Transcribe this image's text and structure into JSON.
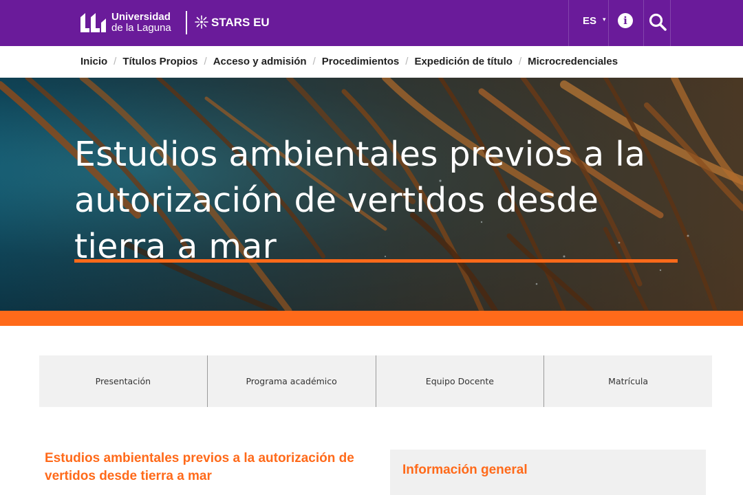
{
  "header": {
    "logo_line1": "Universidad",
    "logo_line2": "de la Laguna",
    "stars_label": "STARS EU",
    "language": "ES"
  },
  "nav": {
    "items": [
      {
        "label": "Inicio"
      },
      {
        "label": "Títulos Propios"
      },
      {
        "label": "Acceso y admisión"
      },
      {
        "label": "Procedimientos"
      },
      {
        "label": "Expedición de título"
      },
      {
        "label": "Microcredenciales"
      }
    ],
    "separator": "/"
  },
  "hero": {
    "title": "Estudios ambientales previos a la autorización de vertidos desde tierra a mar"
  },
  "tabs": [
    {
      "label": "Presentación"
    },
    {
      "label": "Programa académico"
    },
    {
      "label": "Equipo Docente"
    },
    {
      "label": "Matrícula"
    }
  ],
  "content": {
    "title": "Estudios ambientales previos a la autorización de vertidos desde tierra a mar",
    "info_heading": "Información general"
  },
  "colors": {
    "brand_purple": "#6a1b9a",
    "accent_orange": "#ff6a1a"
  },
  "icons": {
    "logo": "ull-logo-icon",
    "stars": "stars-eu-icon",
    "info": "info-icon",
    "search": "search-icon",
    "caret": "chevron-down-icon"
  }
}
